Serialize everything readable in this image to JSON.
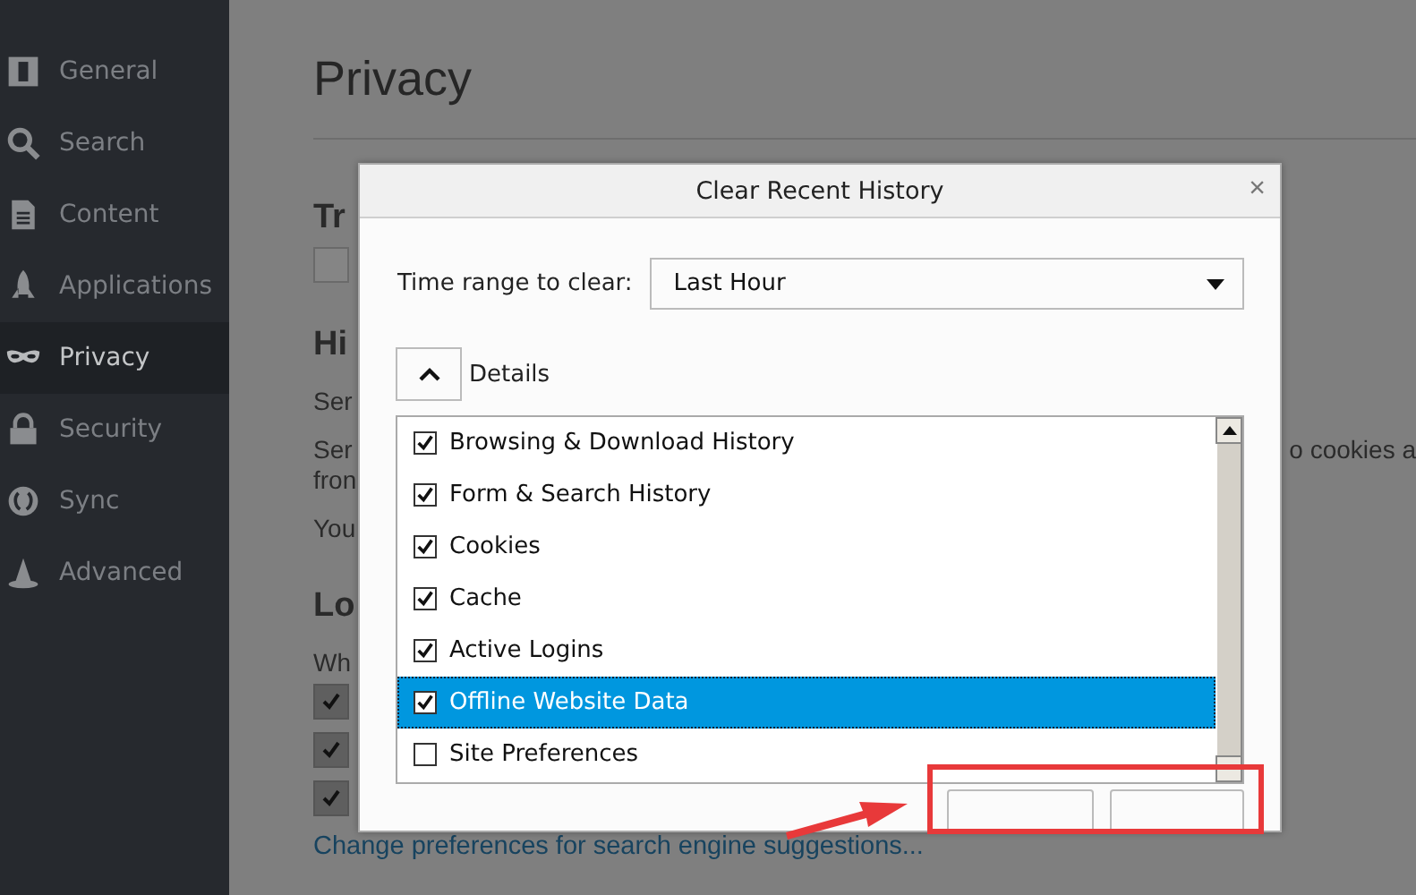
{
  "sidebar": {
    "items": [
      {
        "label": "General",
        "selected": false
      },
      {
        "label": "Search",
        "selected": false
      },
      {
        "label": "Content",
        "selected": false
      },
      {
        "label": "Applications",
        "selected": false
      },
      {
        "label": "Privacy",
        "selected": true
      },
      {
        "label": "Security",
        "selected": false
      },
      {
        "label": "Sync",
        "selected": false
      },
      {
        "label": "Advanced",
        "selected": false
      }
    ]
  },
  "page": {
    "title": "Privacy",
    "sections": [
      {
        "heading": "Tr",
        "items": [
          {
            "kind": "checkbox",
            "checked": false
          }
        ]
      },
      {
        "heading": "Hi",
        "items": [
          {
            "kind": "paragraph",
            "lines": [
              "Ser"
            ]
          },
          {
            "kind": "paragraph",
            "lines": [
              "Ser",
              "fron"
            ],
            "right_text": "o cookies a"
          },
          {
            "kind": "paragraph",
            "lines": [
              "You"
            ]
          }
        ]
      },
      {
        "heading": "Lo",
        "items": [
          {
            "kind": "paragraph",
            "lines": [
              "Wh"
            ]
          },
          {
            "kind": "checkbox",
            "checked": true
          },
          {
            "kind": "checkbox",
            "checked": true
          },
          {
            "kind": "checkbox",
            "checked": true
          },
          {
            "kind": "link",
            "text": "Change preferences for search engine suggestions..."
          }
        ]
      }
    ]
  },
  "dialog": {
    "title": "Clear Recent History",
    "close_label": "×",
    "time_range": {
      "label": "Time range to clear:",
      "value": "Last Hour"
    },
    "details": {
      "label": "Details",
      "expanded": true
    },
    "items": [
      {
        "label": "Browsing & Download History",
        "checked": true,
        "selected": false
      },
      {
        "label": "Form & Search History",
        "checked": true,
        "selected": false
      },
      {
        "label": "Cookies",
        "checked": true,
        "selected": false
      },
      {
        "label": "Cache",
        "checked": true,
        "selected": false
      },
      {
        "label": "Active Logins",
        "checked": true,
        "selected": false
      },
      {
        "label": "Offline Website Data",
        "checked": true,
        "selected": true
      },
      {
        "label": "Site Preferences",
        "checked": false,
        "selected": false
      }
    ],
    "footer_buttons": [
      {
        "kind": "button"
      },
      {
        "kind": "button"
      }
    ]
  }
}
